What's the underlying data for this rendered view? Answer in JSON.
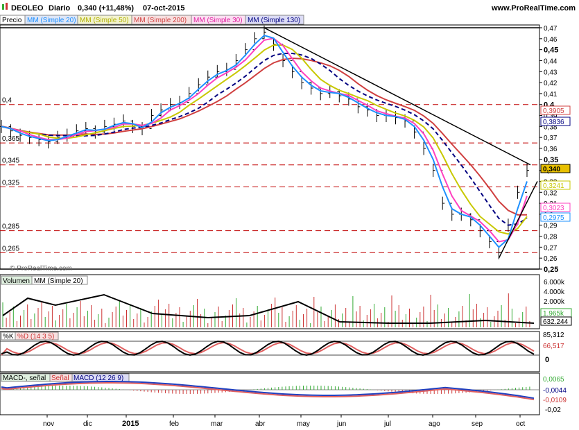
{
  "header": {
    "symbol": "DEOLEO",
    "period": "Diario",
    "last": "0,340 (+11,48%)",
    "date": "07-oct-2015",
    "site": "www.ProRealTime.com",
    "watermark": "© ProRealTime.com"
  },
  "legend": {
    "ma20": "MM (Simple 20)",
    "ma50": "MM (Simple 50)",
    "ma200": "MM (Simple 200)",
    "ma30": "MM (Simple 30)",
    "ma130": "MM (Simple 130)",
    "price": "Precio",
    "volume": "Volumen",
    "volume_ma": "MM (Simple 20)",
    "stoch_k": "%K",
    "stoch_d": "%D (14 3 5)",
    "macd_hist": "MACD-, señal",
    "macd_signal": "Señal",
    "macd": "MACD (12 26 9)"
  },
  "colors": {
    "ma20": "#1e90ff",
    "ma50": "#c8c800",
    "ma200": "#d04040",
    "ma30": "#ff40c0",
    "ma130": "#000080",
    "support": "#c00000",
    "vol_up": "#33aa33",
    "vol_down": "#cc3333"
  },
  "chart_data": [
    {
      "panel": "price",
      "type": "ohlc",
      "ylim": [
        0.25,
        0.47
      ],
      "y_ticks": [
        "0,47",
        "0,46",
        "0,45",
        "0,44",
        "0,43",
        "0,42",
        "0,41",
        "0,4",
        "0,39",
        "0,38",
        "0,37",
        "0,36",
        "0,35",
        "0,34",
        "0,33",
        "0,32",
        "0,31",
        "0,3",
        "0,29",
        "0,28",
        "0,27",
        "0,26",
        "0,25"
      ],
      "y_ticks_bold": [
        "0,45",
        "0,4",
        "0,35",
        "0,25"
      ],
      "x_labels": [
        "nov",
        "dic",
        "2015",
        "feb",
        "mar",
        "abr",
        "may",
        "jun",
        "jul",
        "ago",
        "sep",
        "oct"
      ],
      "support_levels": [
        {
          "value": 0.4,
          "label": "0,4"
        },
        {
          "value": 0.365,
          "label": "0,365"
        },
        {
          "value": 0.345,
          "label": "0,345"
        },
        {
          "value": 0.325,
          "label": "0,325"
        },
        {
          "value": 0.285,
          "label": "0,285"
        },
        {
          "value": 0.265,
          "label": "0,265"
        }
      ],
      "left_labels": [
        "0,47",
        "0,4",
        "0,365",
        "0,345",
        "0,325",
        "0,285",
        "0,265",
        "0,25"
      ],
      "series_close": [
        0.38,
        0.376,
        0.372,
        0.37,
        0.368,
        0.366,
        0.37,
        0.372,
        0.376,
        0.378,
        0.375,
        0.38,
        0.382,
        0.385,
        0.38,
        0.378,
        0.39,
        0.395,
        0.4,
        0.402,
        0.41,
        0.418,
        0.425,
        0.43,
        0.432,
        0.44,
        0.45,
        0.46,
        0.466,
        0.455,
        0.44,
        0.43,
        0.42,
        0.415,
        0.41,
        0.412,
        0.408,
        0.405,
        0.398,
        0.395,
        0.39,
        0.39,
        0.388,
        0.385,
        0.375,
        0.36,
        0.34,
        0.31,
        0.3,
        0.3,
        0.295,
        0.285,
        0.275,
        0.265,
        0.29,
        0.32,
        0.34
      ],
      "value_tags": [
        {
          "label": "0,3905",
          "series": "ma200"
        },
        {
          "label": "0,3836",
          "series": "ma130"
        },
        {
          "label": "0,340",
          "series": "price"
        },
        {
          "label": "0,3241",
          "series": "ma50"
        },
        {
          "label": "0,3023",
          "series": "ma30"
        },
        {
          "label": "0,2975",
          "series": "ma20"
        }
      ],
      "trendlines": [
        "resistance from may high to oct",
        "support in late sep-oct"
      ]
    },
    {
      "panel": "volume",
      "type": "bar",
      "y_ticks": [
        "6.000k",
        "4.000k",
        "2.000k"
      ],
      "value_tags": [
        {
          "label": "1.965k"
        },
        {
          "label": "632.244"
        }
      ]
    },
    {
      "panel": "stochastic",
      "type": "line",
      "value_tags": [
        {
          "label": "85,312"
        },
        {
          "label": "66,517"
        }
      ],
      "y_ticks": [
        "0"
      ]
    },
    {
      "panel": "macd",
      "type": "line",
      "value_tags": [
        {
          "label": "0,0065"
        },
        {
          "label": "-0,0044"
        },
        {
          "label": "-0,0109"
        }
      ],
      "y_ticks": [
        "-0,02"
      ]
    }
  ]
}
